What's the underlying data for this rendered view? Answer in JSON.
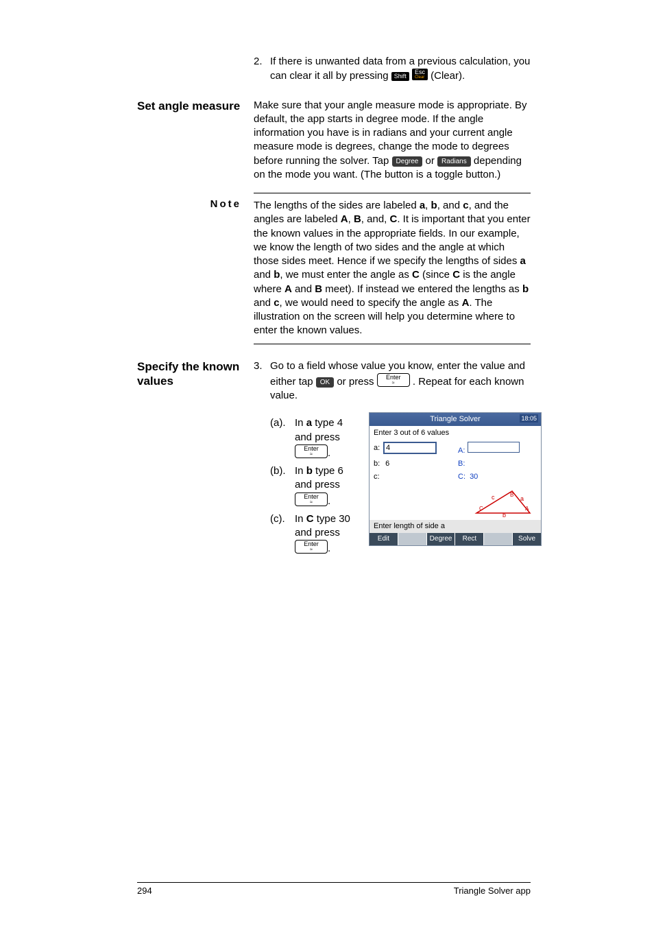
{
  "step2": {
    "marker": "2.",
    "text_before_keys": "If there is unwanted data from a previous calculation, you can clear it all by pressing ",
    "key_shift": "Shift",
    "key_esc_top": "Esc",
    "key_esc_sub": "Clear",
    "text_after_keys": " (Clear)."
  },
  "set_angle": {
    "heading": "Set angle measure",
    "body_a": "Make sure that your angle measure mode is appropriate. By default, the app starts in degree mode. If the angle information you have is in radians and your current angle measure mode is degrees, change the mode to degrees before running the solver. Tap ",
    "btn_degree": "Degree",
    "mid": " or ",
    "btn_radians": "Radians",
    "body_b": " depending on the mode you want. (The button is a toggle button.)"
  },
  "note": {
    "label": "Note",
    "p1": "The lengths of the sides are labeled ",
    "a": "a",
    "b": "b",
    "c": "c",
    "p2": ", and the angles are labeled ",
    "A": "A",
    "B": "B",
    "C": "C",
    "p3": ". It is important that you enter the known values in the appropriate fields. In our example, we know the length of two sides and the angle at which those sides meet. Hence if we specify the lengths of sides ",
    "p4": ", we must enter the angle as ",
    "p5": " (since ",
    "p6": " is the angle where ",
    "p7": " meet). If instead we entered the lengths as ",
    "p8": ", we would need to specify the angle as ",
    "p9": ". The illustration on the screen will help you determine where to enter the known values."
  },
  "specify": {
    "heading": "Specify the known values",
    "step3_marker": "3.",
    "step3_a": "Go to a field whose value you know, enter the value and either tap ",
    "ok_btn": "OK",
    "step3_b": " or press ",
    "enter_key": "Enter",
    "enter_sub": "≈",
    "step3_c": ". Repeat for each known value.",
    "sub_a_m": "(a).",
    "sub_a_t1": "In ",
    "sub_a_bold": "a",
    "sub_a_t2": " type 4 and press ",
    "sub_b_m": "(b).",
    "sub_b_t1": "In ",
    "sub_b_bold": "b",
    "sub_b_t2": " type 6 and press ",
    "sub_c_m": "(c).",
    "sub_c_t1": "In ",
    "sub_c_bold": "C",
    "sub_c_t2": " type 30 and press "
  },
  "screenshot": {
    "title": "Triangle Solver",
    "time": "18:05",
    "subtitle": "Enter 3 out of 6 values",
    "rows": {
      "a_label": "a:",
      "a_val": "4",
      "A_label": "A:",
      "A_val": "",
      "b_label": "b:",
      "b_val": "6",
      "B_label": "B:",
      "B_val": "",
      "c_label": "c:",
      "c_val": "",
      "C_label": "C:",
      "C_val": "30"
    },
    "tri_labels": {
      "a": "a",
      "b": "b",
      "c": "c",
      "A": "A",
      "B": "B",
      "C": "C"
    },
    "hint": "Enter length of side a",
    "buttons": [
      "Edit",
      "",
      "Degree",
      "Rect",
      "",
      "Solve"
    ]
  },
  "footer": {
    "page": "294",
    "title": "Triangle Solver app"
  }
}
